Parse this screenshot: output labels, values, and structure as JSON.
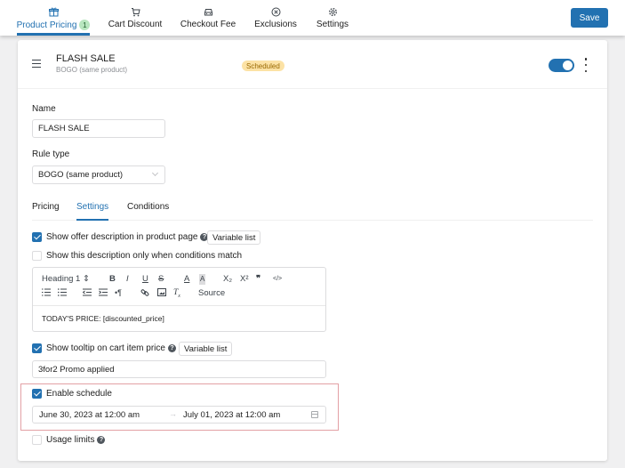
{
  "topnav": {
    "tabs": [
      {
        "label": "Product Pricing",
        "icon": "gift-icon",
        "badge": "1",
        "active": true
      },
      {
        "label": "Cart Discount",
        "icon": "cart-icon",
        "active": false
      },
      {
        "label": "Checkout Fee",
        "icon": "car-icon",
        "active": false
      },
      {
        "label": "Exclusions",
        "icon": "circle-x-icon",
        "active": false
      },
      {
        "label": "Settings",
        "icon": "gear-icon",
        "active": false
      }
    ],
    "save_label": "Save"
  },
  "rule": {
    "title": "FLASH SALE",
    "subtitle": "BOGO (same product)",
    "status": "Scheduled",
    "enabled": true
  },
  "form": {
    "name_label": "Name",
    "name_value": "FLASH SALE",
    "rule_type_label": "Rule type",
    "rule_type_value": "BOGO (same product)",
    "subtabs": [
      {
        "label": "Pricing",
        "active": false
      },
      {
        "label": "Settings",
        "active": true
      },
      {
        "label": "Conditions",
        "active": false
      }
    ]
  },
  "settings": {
    "show_offer_desc": {
      "label": "Show offer description in product page",
      "checked": true,
      "help": "?"
    },
    "variable_list_label": "Variable list",
    "show_desc_conditions": {
      "label": "Show this description only when conditions match",
      "checked": false
    },
    "editor": {
      "heading_select": "Heading 1",
      "toolbar_row1": [
        "B",
        "I",
        "U",
        "S",
        "A",
        "A",
        "X₂",
        "X²",
        "❞",
        "</>"
      ],
      "source_label": "Source",
      "content": "TODAY'S PRICE: [discounted_price]"
    },
    "show_tooltip": {
      "label": "Show tooltip on cart item price",
      "checked": true,
      "help": "?"
    },
    "tooltip_value": "3for2 Promo applied",
    "enable_schedule": {
      "label": "Enable schedule",
      "checked": true
    },
    "schedule_start": "June 30, 2023 at 12:00 am",
    "schedule_arrow": "→",
    "schedule_end": "July 01, 2023 at 12:00 am",
    "usage_limits": {
      "label": "Usage limits",
      "checked": false,
      "help": "?"
    }
  },
  "colors": {
    "accent": "#2271b1",
    "badge_bg": "#fce2a5",
    "badge_text": "#996800",
    "highlight_border": "#e3a0a5"
  }
}
